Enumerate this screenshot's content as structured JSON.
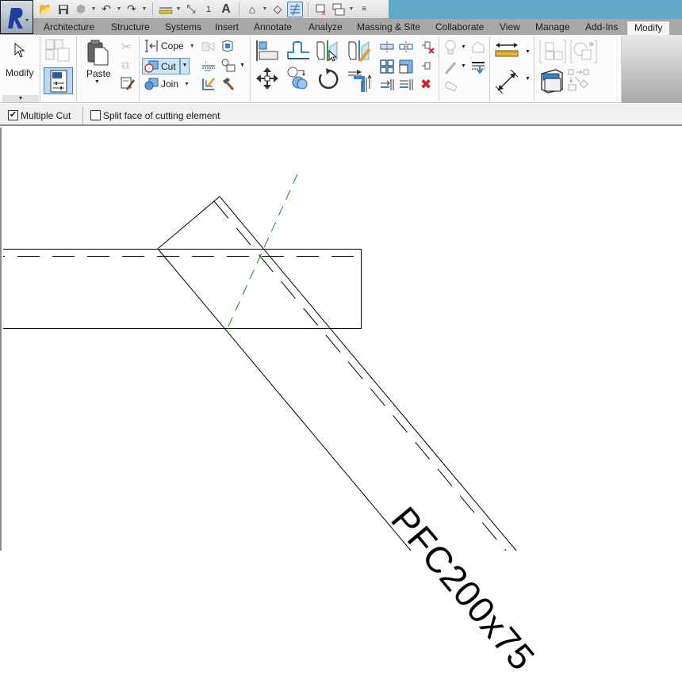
{
  "quick_access_toolbar": {
    "items": [
      "open-icon",
      "save-icon",
      "sync-icon",
      "undo-icon",
      "redo-icon",
      "aligned-dimension-icon",
      "measure-icon",
      "tag-icon",
      "text-icon",
      "3d-view-icon",
      "section-icon",
      "thin-lines-icon",
      "close-hidden-icon",
      "switch-windows-icon",
      "customize-icon"
    ],
    "text_icon_glyph": "A",
    "tag_icon_glyph": "1"
  },
  "tabs": [
    {
      "label": "Architecture"
    },
    {
      "label": "Structure"
    },
    {
      "label": "Systems"
    },
    {
      "label": "Insert"
    },
    {
      "label": "Annotate"
    },
    {
      "label": "Analyze"
    },
    {
      "label": "Massing & Site"
    },
    {
      "label": "Collaborate"
    },
    {
      "label": "View"
    },
    {
      "label": "Manage"
    },
    {
      "label": "Add-Ins"
    },
    {
      "label": "Modify",
      "active": true
    }
  ],
  "ribbon": {
    "modify_label": "Modify",
    "paste_label": "Paste",
    "cope_label": "Cope",
    "cut_label": "Cut",
    "join_label": "Join"
  },
  "options_bar": {
    "multiple_cut": {
      "label": "Multiple Cut",
      "checked": true
    },
    "split_face": {
      "label": "Split face of cutting element",
      "checked": false
    }
  },
  "canvas": {
    "tag_text": "PFC200x75",
    "colors": {
      "line": "#000000",
      "reference_line": "#1a8a1a",
      "accent": "#3a82c8"
    }
  }
}
